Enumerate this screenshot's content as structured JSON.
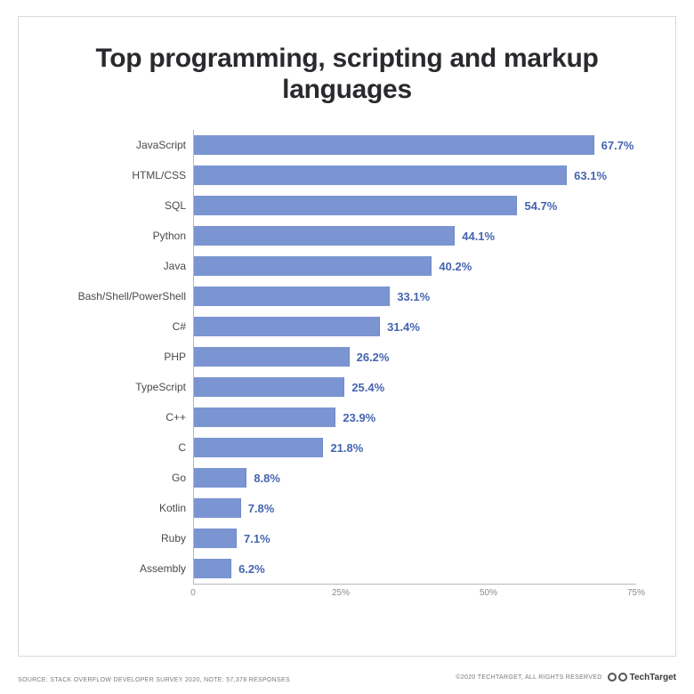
{
  "title": "Top programming, scripting and markup languages",
  "chart_data": {
    "type": "bar",
    "orientation": "horizontal",
    "xlabel": "",
    "ylabel": "",
    "xlim": [
      0,
      75
    ],
    "categories": [
      "JavaScript",
      "HTML/CSS",
      "SQL",
      "Python",
      "Java",
      "Bash/Shell/PowerShell",
      "C#",
      "PHP",
      "TypeScript",
      "C++",
      "C",
      "Go",
      "Kotlin",
      "Ruby",
      "Assembly"
    ],
    "values": [
      67.7,
      63.1,
      54.7,
      44.1,
      40.2,
      33.1,
      31.4,
      26.2,
      25.4,
      23.9,
      21.8,
      8.8,
      7.8,
      7.1,
      6.2
    ],
    "value_suffix": "%",
    "ticks": [
      0,
      25,
      50,
      75
    ],
    "tick_labels": [
      "0",
      "25%",
      "50%",
      "75%"
    ],
    "bar_color": "#7a95d1",
    "label_color": "#4564b0"
  },
  "footer": {
    "source": "SOURCE: STACK OVERFLOW DEVELOPER SURVEY 2020, NOTE: 57,378 RESPONSES",
    "copyright": "©2020 TECHTARGET, ALL RIGHTS RESERVED",
    "brand": "TechTarget"
  }
}
